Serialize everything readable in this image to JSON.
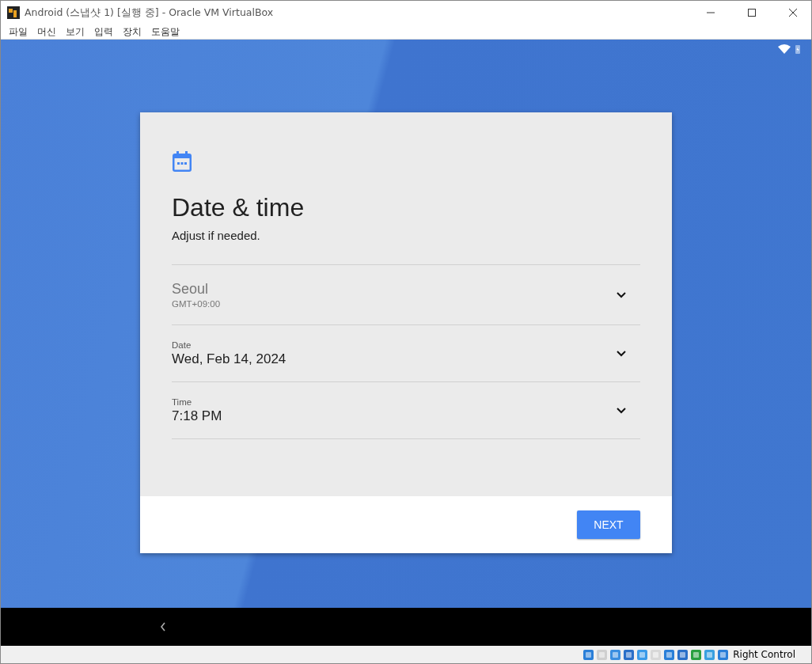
{
  "window": {
    "title": "Android (스냅샷 1) [실행 중] - Oracle VM VirtualBox"
  },
  "menu": [
    "파일",
    "머신",
    "보기",
    "입력",
    "장치",
    "도움말"
  ],
  "card": {
    "title": "Date & time",
    "subtitle": "Adjust if needed.",
    "rows": [
      {
        "kind": "zone",
        "primary": "Seoul",
        "secondary": "GMT+09:00",
        "disabled": true
      },
      {
        "kind": "field",
        "label": "Date",
        "value": "Wed, Feb 14, 2024",
        "disabled": false
      },
      {
        "kind": "field",
        "label": "Time",
        "value": "7:18 PM",
        "disabled": false
      }
    ],
    "button": "NEXT"
  },
  "status_bar": {
    "host_key": "Right Control"
  }
}
